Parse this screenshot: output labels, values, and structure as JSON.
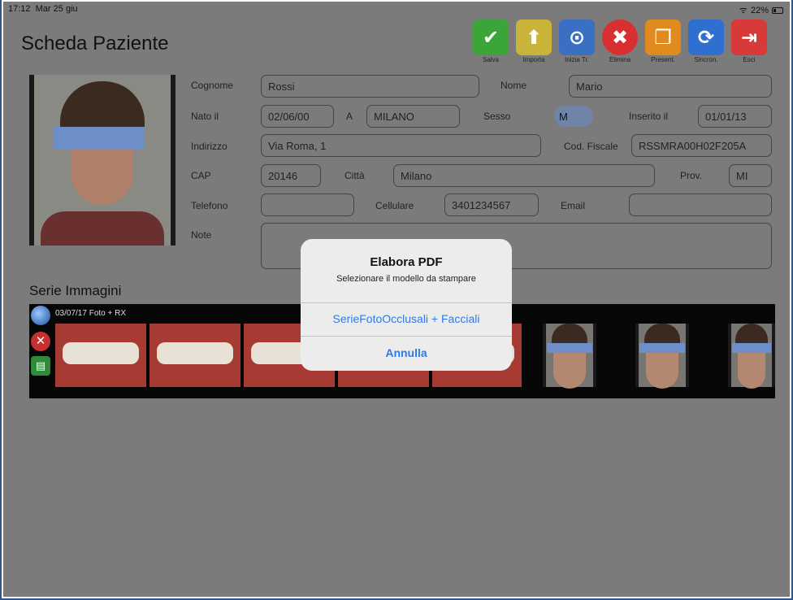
{
  "status": {
    "time": "17:12",
    "date": "Mar 25 giu",
    "battery": "22%"
  },
  "title": "Scheda Paziente",
  "toolbar": [
    {
      "label": "Salva",
      "icon": "check-icon",
      "color": "#3aa63a",
      "glyph": "✔"
    },
    {
      "label": "Importa",
      "icon": "folder-upload-icon",
      "color": "#c9b43a",
      "glyph": "⬆"
    },
    {
      "label": "Inizia Tr.",
      "icon": "start-treatment-icon",
      "color": "#3a6fc4",
      "glyph": "⊙"
    },
    {
      "label": "Elimina",
      "icon": "delete-icon",
      "color": "#d83030",
      "glyph": "✖"
    },
    {
      "label": "Present.",
      "icon": "presentation-icon",
      "color": "#e08a20",
      "glyph": "❐"
    },
    {
      "label": "Sincron.",
      "icon": "sync-icon",
      "color": "#2f6fd0",
      "glyph": "⟳"
    },
    {
      "label": "Esci",
      "icon": "exit-icon",
      "color": "#d83a3a",
      "glyph": "⇥"
    }
  ],
  "form": {
    "cognome_label": "Cognome",
    "cognome": "Rossi",
    "nome_label": "Nome",
    "nome": "Mario",
    "nato_label": "Nato il",
    "nato": "02/06/00",
    "a_label": "A",
    "luogo": "MILANO",
    "sesso_label": "Sesso",
    "sesso": "M",
    "inserito_label": "Inserito il",
    "inserito": "01/01/13",
    "indirizzo_label": "Indirizzo",
    "indirizzo": "Via Roma, 1",
    "cf_label": "Cod. Fiscale",
    "cf": "RSSMRA00H02F205A",
    "cap_label": "CAP",
    "cap": "20146",
    "citta_label": "Città",
    "citta": "Milano",
    "prov_label": "Prov.",
    "prov": "MI",
    "telefono_label": "Telefono",
    "telefono": "",
    "cellulare_label": "Cellulare",
    "cellulare": "3401234567",
    "email_label": "Email",
    "email": "",
    "note_label": "Note",
    "note": ""
  },
  "series": {
    "title": "Serie Immagini",
    "entry": "03/07/17 Foto + RX"
  },
  "alert": {
    "title": "Elabora PDF",
    "message": "Selezionare il modello da stampare",
    "option": "SerieFotoOcclusali + Facciali",
    "cancel": "Annulla"
  }
}
